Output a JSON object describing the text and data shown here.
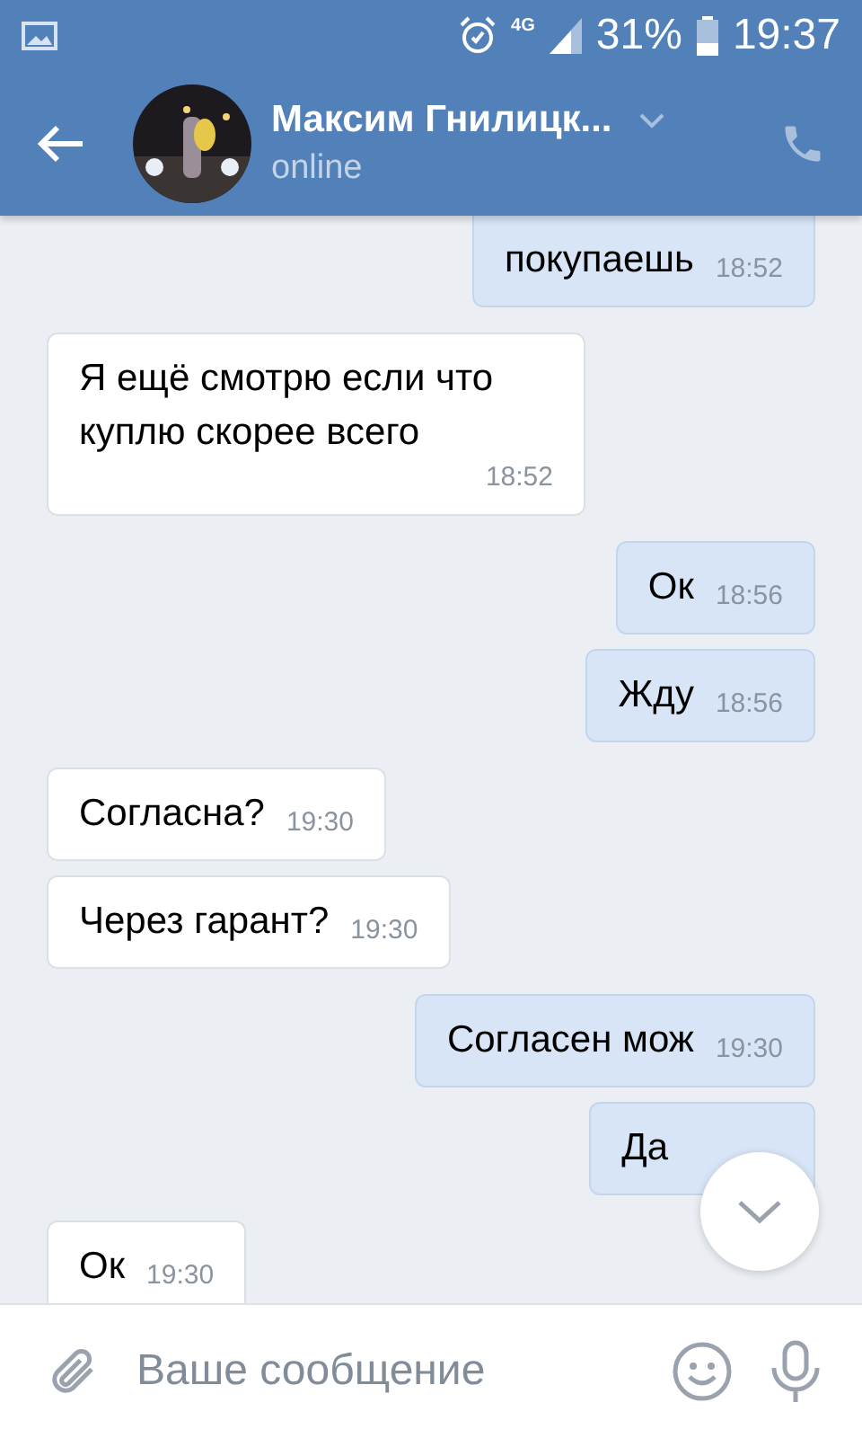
{
  "status_bar": {
    "network": "4G",
    "battery": "31%",
    "time": "19:37"
  },
  "header": {
    "name": "Максим Гнилицк...",
    "status": "online"
  },
  "messages": [
    {
      "kind": "outgoing",
      "text": "покупаешь",
      "time": "18:52"
    },
    {
      "kind": "incoming",
      "text": "Я ещё смотрю если что куплю скорее всего",
      "time": "18:52"
    },
    {
      "kind": "outgoing",
      "text": "Ок",
      "time": "18:56"
    },
    {
      "kind": "outgoing",
      "text": "Жду",
      "time": "18:56"
    },
    {
      "kind": "incoming",
      "text": "Согласна?",
      "time": "19:30"
    },
    {
      "kind": "incoming",
      "text": "Через гарант?",
      "time": "19:30"
    },
    {
      "kind": "outgoing",
      "text": "Согласен мож",
      "time": "19:30"
    },
    {
      "kind": "outgoing",
      "text": "Да"
    },
    {
      "kind": "incoming",
      "text": "Ок",
      "time": "19:30"
    }
  ],
  "composer": {
    "placeholder": "Ваше сообщение"
  }
}
